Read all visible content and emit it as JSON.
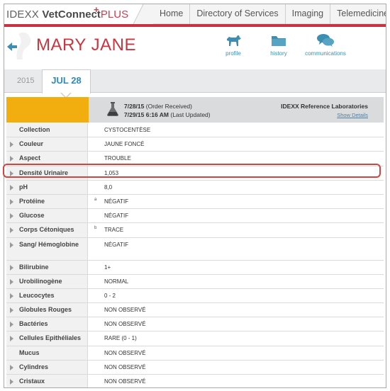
{
  "brand": {
    "idexx": "IDEXX ",
    "vetconnect": "VetConnect",
    "plus_text": "PLUS",
    "plus_mark": "+"
  },
  "nav": [
    "Home",
    "Directory of Services",
    "Imaging",
    "Telemedicine"
  ],
  "patient": {
    "name": "MARY JANE"
  },
  "actions": [
    {
      "label": "profile",
      "icon": "dog-icon"
    },
    {
      "label": "history",
      "icon": "folder-icon"
    },
    {
      "label": "communications",
      "icon": "chat-bubbles-icon"
    }
  ],
  "dates": {
    "year": "2015",
    "active": "JUL 28"
  },
  "report": {
    "received_date": "7/28/15",
    "received_status": "(Order Received)",
    "updated_date": "7/29/15 6:16 AM",
    "updated_status": "(Last Updated)",
    "lab": "IDEXX Reference Laboratories",
    "show_details": "Show Details"
  },
  "results": [
    {
      "name": "Collection",
      "value": "CYSTOCENTÈSE",
      "expandable": false,
      "flag": ""
    },
    {
      "name": "Couleur",
      "value": "JAUNE FONCÉ",
      "expandable": true,
      "flag": ""
    },
    {
      "name": "Aspect",
      "value": "TROUBLE",
      "expandable": true,
      "flag": ""
    },
    {
      "name": "Densité Urinaire",
      "value": "1,053",
      "expandable": true,
      "flag": "",
      "highlighted": true
    },
    {
      "name": "pH",
      "value": "8,0",
      "expandable": true,
      "flag": ""
    },
    {
      "name": "Protéine",
      "value": "NÉGATIF",
      "expandable": true,
      "flag": "a"
    },
    {
      "name": "Glucose",
      "value": "NÉGATIF",
      "expandable": true,
      "flag": ""
    },
    {
      "name": "Corps Cétoniques",
      "value": "TRACE",
      "expandable": true,
      "flag": "b"
    },
    {
      "name": "Sang/ Hémoglobine",
      "value": "NÉGATIF",
      "expandable": true,
      "flag": "",
      "tall": true
    },
    {
      "name": "Bilirubine",
      "value": "1+",
      "expandable": true,
      "flag": ""
    },
    {
      "name": "Urobilinogène",
      "value": "NORMAL",
      "expandable": true,
      "flag": ""
    },
    {
      "name": "Leucocytes",
      "value": "0 - 2",
      "expandable": true,
      "flag": ""
    },
    {
      "name": "Globules Rouges",
      "value": "NON OBSERVÉ",
      "expandable": true,
      "flag": ""
    },
    {
      "name": "Bactéries",
      "value": "NON OBSERVÉ",
      "expandable": true,
      "flag": ""
    },
    {
      "name": "Cellules Epithéliales",
      "value": "RARE (0 - 1)",
      "expandable": true,
      "flag": ""
    },
    {
      "name": "Mucus",
      "value": "NON OBSERVÉ",
      "expandable": false,
      "flag": ""
    },
    {
      "name": "Cylindres",
      "value": "NON OBSERVÉ",
      "expandable": true,
      "flag": ""
    },
    {
      "name": "Cristaux",
      "value": "NON OBSERVÉ",
      "expandable": true,
      "flag": ""
    }
  ],
  "colors": {
    "brand_red": "#c83344",
    "accent_blue": "#2f8bb3",
    "gold": "#f2ad0f",
    "highlight": "#d2443f"
  }
}
